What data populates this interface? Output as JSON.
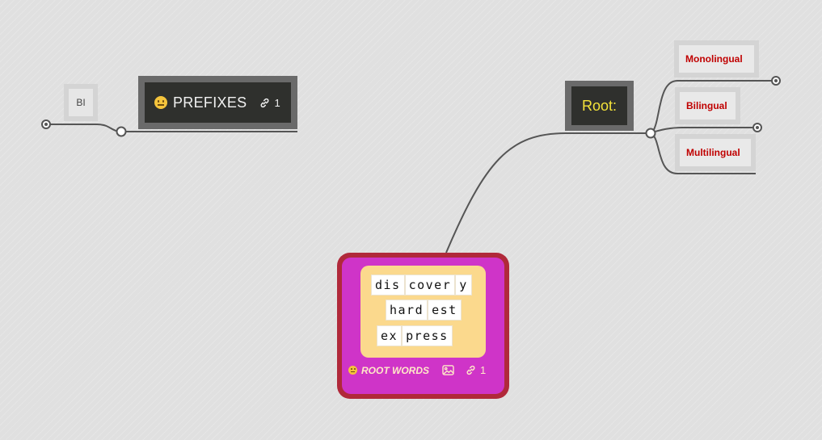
{
  "nodes": {
    "bi": {
      "label": "BI"
    },
    "prefixes": {
      "label": "PREFIXES",
      "link_count": "1",
      "icon": "neutral-face-emoji"
    },
    "root": {
      "label": "Root:"
    },
    "branches": [
      {
        "label": "Monolingual"
      },
      {
        "label": "Bilingual"
      },
      {
        "label": "Multilingual"
      }
    ],
    "root_words": {
      "label": "ROOT WORDS",
      "link_count": "1",
      "icons": [
        "neutral-face-emoji",
        "image-icon",
        "link-icon"
      ],
      "words": [
        {
          "tiles": [
            "dis",
            "cover",
            "y"
          ]
        },
        {
          "tiles": [
            "hard",
            "est"
          ]
        },
        {
          "tiles": [
            "ex",
            "press"
          ]
        }
      ]
    }
  },
  "colors": {
    "background": "#e0e0e0",
    "dark_node": "#2f302d",
    "dark_node_border": "#6a6a6a",
    "root_label": "#f4e33a",
    "branch_text": "#c00000",
    "root_words_outer": "#b0293a",
    "root_words_fill": "#cf34c8",
    "word_panel": "#fbd98d",
    "connector": "#555555"
  }
}
